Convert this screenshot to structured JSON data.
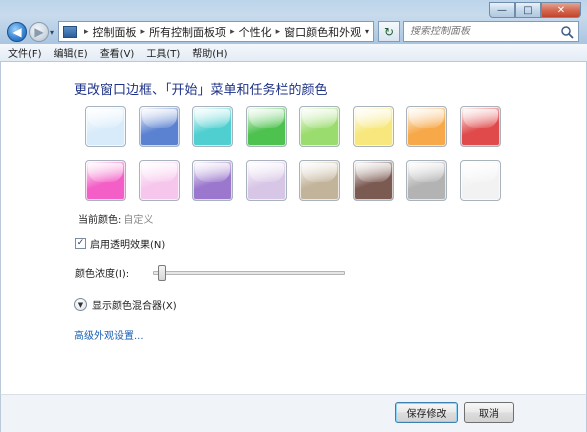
{
  "window": {
    "minimize": "—",
    "maximize": "□",
    "close": "✕"
  },
  "nav": {
    "back_glyph": "◀",
    "forward_glyph": "▶",
    "recent_glyph": "▾"
  },
  "address": {
    "breadcrumbs": [
      "控制面板",
      "所有控制面板项",
      "个性化",
      "窗口颜色和外观"
    ],
    "separator": "▸",
    "dropdown_glyph": "▾",
    "refresh_glyph": "↻"
  },
  "search": {
    "placeholder": "搜索控制面板"
  },
  "menu": {
    "items": [
      "文件(F)",
      "编辑(E)",
      "查看(V)",
      "工具(T)",
      "帮助(H)"
    ]
  },
  "main": {
    "heading": "更改窗口边框、「开始」菜单和任务栏的颜色",
    "swatch_colors": [
      [
        "#d7ebfa",
        "#5b82d1",
        "#4fcfd0",
        "#4ec24e",
        "#9bdc6e",
        "#f7e77c",
        "#f7a94a",
        "#e04a4a"
      ],
      [
        "#f35fc6",
        "#f7c6ec",
        "#9b78cd",
        "#d8c6e6",
        "#c2b49a",
        "#7b5a52",
        "#b3b3b3",
        "#f2f2f2"
      ]
    ],
    "current_color_label": "当前颜色:",
    "current_color_value": "自定义",
    "transparency_label": "启用透明效果(N)",
    "transparency_checked": true,
    "intensity_label": "颜色浓度(I):",
    "intensity_value": 0.02,
    "mixer_label": "显示颜色混合器(X)",
    "advanced_link": "高级外观设置..."
  },
  "footer": {
    "save_label": "保存修改",
    "cancel_label": "取消"
  }
}
